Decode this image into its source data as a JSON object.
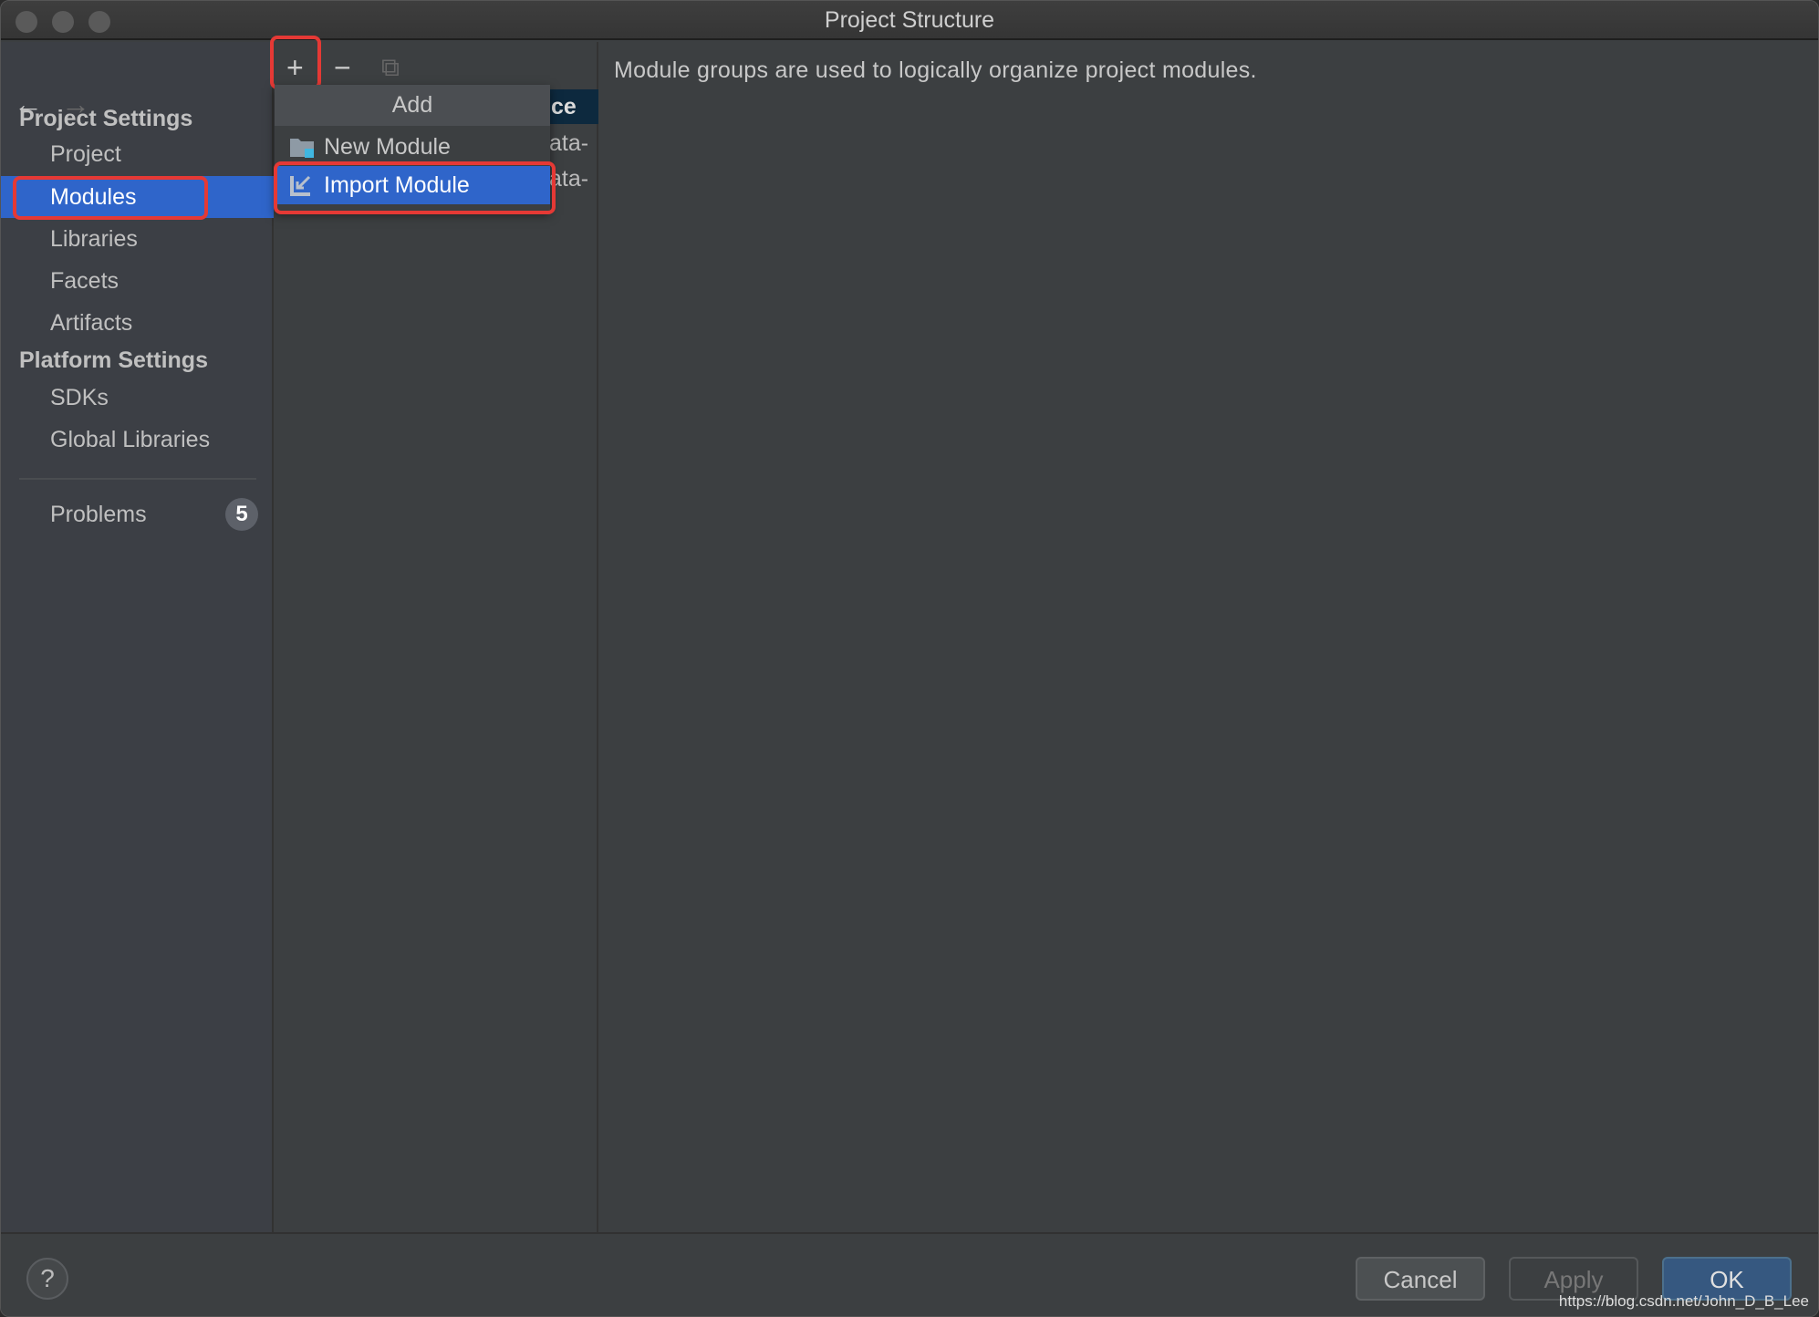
{
  "window": {
    "title": "Project Structure"
  },
  "nav": {
    "back_icon": "arrow-left-icon",
    "forward_icon": "arrow-right-icon"
  },
  "sidebar": {
    "project_settings_header": "Project Settings",
    "project_items": [
      {
        "label": "Project"
      },
      {
        "label": "Modules",
        "selected": true
      },
      {
        "label": "Libraries"
      },
      {
        "label": "Facets"
      },
      {
        "label": "Artifacts"
      }
    ],
    "platform_settings_header": "Platform Settings",
    "platform_items": [
      {
        "label": "SDKs"
      },
      {
        "label": "Global Libraries"
      }
    ],
    "problems": {
      "label": "Problems",
      "count": "5"
    }
  },
  "toolbar": {
    "add_icon": "plus-icon",
    "remove_icon": "minus-icon",
    "copy_icon": "copy-icon"
  },
  "module_list": {
    "selected_fragment": "ce",
    "items": [
      "ata-",
      "ata-"
    ]
  },
  "add_popup": {
    "title": "Add",
    "items": [
      {
        "label": "New Module",
        "icon": "folder-module-icon"
      },
      {
        "label": "Import Module",
        "icon": "import-icon",
        "selected": true
      }
    ]
  },
  "main": {
    "description": "Module groups are used to logically organize project modules."
  },
  "footer": {
    "help": "?",
    "cancel": "Cancel",
    "apply": "Apply",
    "ok": "OK",
    "watermark": "https://blog.csdn.net/John_D_B_Lee"
  },
  "colors": {
    "selection": "#2f65ca",
    "highlight_box": "#e53935",
    "ok_button": "#365880"
  }
}
